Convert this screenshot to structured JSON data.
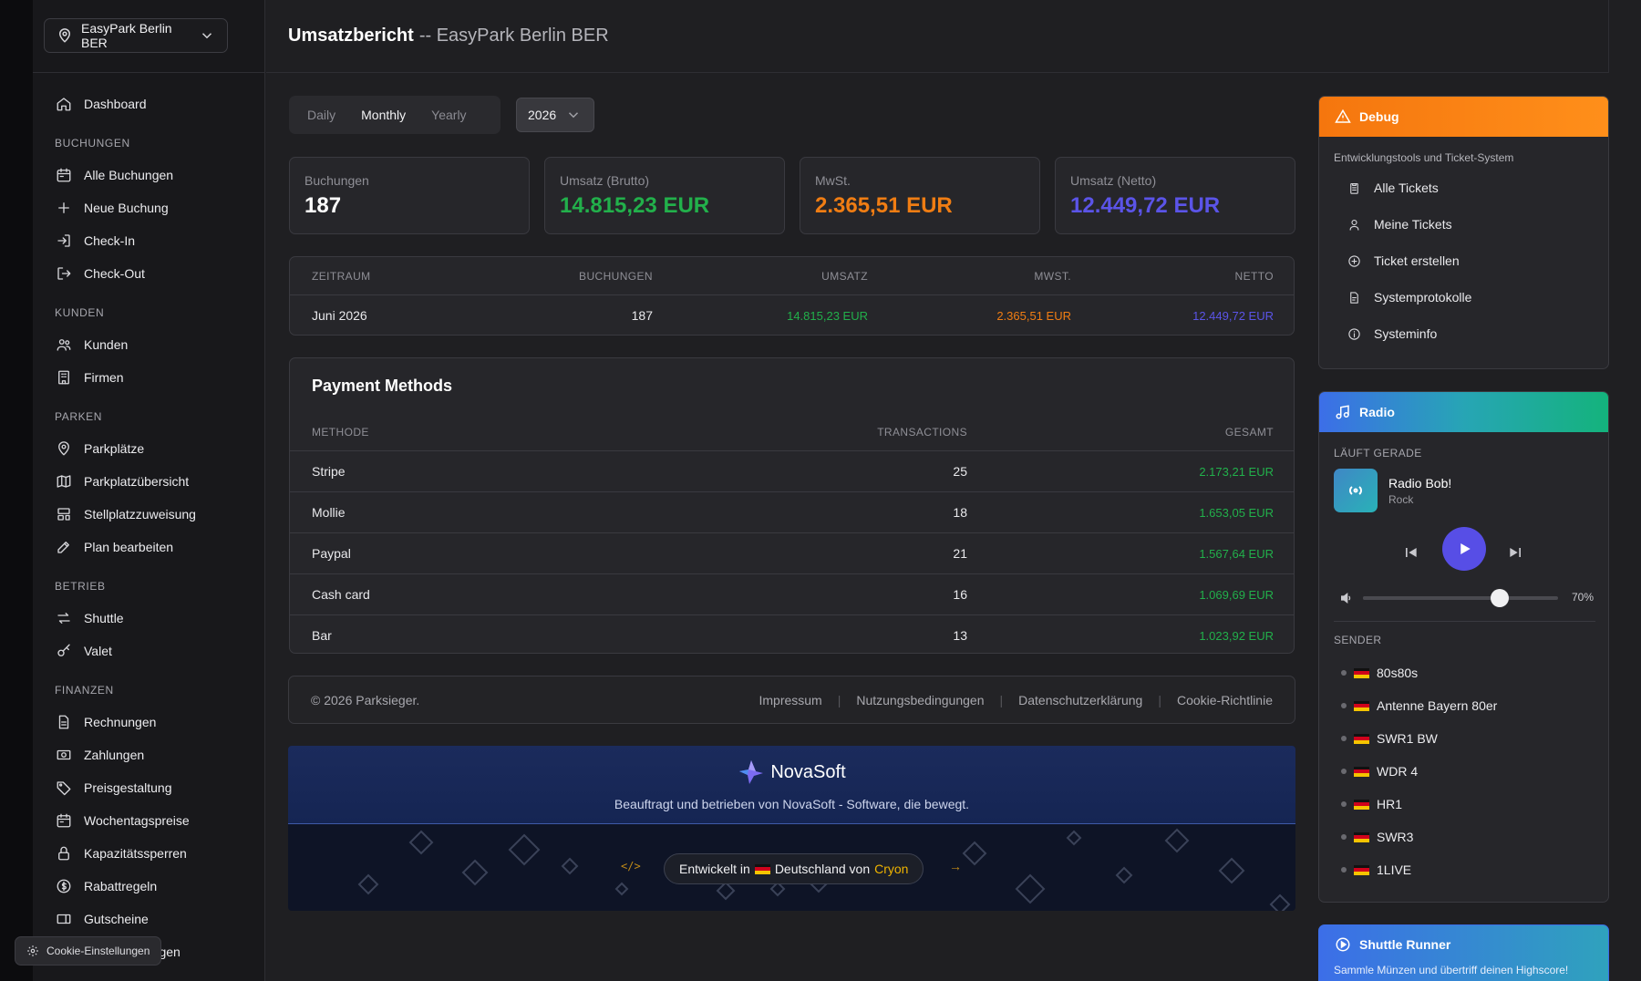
{
  "location": {
    "name": "EasyPark Berlin BER"
  },
  "sidebar": {
    "top": [
      {
        "label": "Dashboard",
        "icon": "home-icon"
      }
    ],
    "sections": [
      {
        "title": "BUCHUNGEN",
        "items": [
          {
            "label": "Alle Buchungen",
            "icon": "calendar-icon"
          },
          {
            "label": "Neue Buchung",
            "icon": "plus-icon"
          },
          {
            "label": "Check-In",
            "icon": "check-in-icon"
          },
          {
            "label": "Check-Out",
            "icon": "check-out-icon"
          }
        ]
      },
      {
        "title": "KUNDEN",
        "items": [
          {
            "label": "Kunden",
            "icon": "users-icon"
          },
          {
            "label": "Firmen",
            "icon": "building-icon"
          }
        ]
      },
      {
        "title": "PARKEN",
        "items": [
          {
            "label": "Parkplätze",
            "icon": "map-pin-icon"
          },
          {
            "label": "Parkplatzübersicht",
            "icon": "map-icon"
          },
          {
            "label": "Stellplatzzuweisung",
            "icon": "assign-icon"
          },
          {
            "label": "Plan bearbeiten",
            "icon": "edit-icon"
          }
        ]
      },
      {
        "title": "BETRIEB",
        "items": [
          {
            "label": "Shuttle",
            "icon": "swap-icon"
          },
          {
            "label": "Valet",
            "icon": "key-icon"
          }
        ]
      },
      {
        "title": "FINANZEN",
        "items": [
          {
            "label": "Rechnungen",
            "icon": "file-icon"
          },
          {
            "label": "Zahlungen",
            "icon": "cash-icon"
          },
          {
            "label": "Preisgestaltung",
            "icon": "tag-icon"
          },
          {
            "label": "Wochentagspreise",
            "icon": "calendar-icon"
          },
          {
            "label": "Kapazitätssperren",
            "icon": "lock-icon"
          },
          {
            "label": "Rabattregeln",
            "icon": "dollar-icon"
          },
          {
            "label": "Gutscheine",
            "icon": "ticket-icon"
          },
          {
            "label": "Zusatzleistungen",
            "icon": "plus-icon"
          }
        ]
      }
    ]
  },
  "header": {
    "title": "Umsatzbericht",
    "subtitle": "-- EasyPark Berlin BER"
  },
  "period": {
    "options": [
      "Daily",
      "Monthly",
      "Yearly"
    ],
    "selected": "Monthly",
    "year": "2026"
  },
  "stats": [
    {
      "label": "Buchungen",
      "value": "187",
      "color": "#ffffff"
    },
    {
      "label": "Umsatz (Brutto)",
      "value": "14.815,23 EUR",
      "color": "#22b04b"
    },
    {
      "label": "MwSt.",
      "value": "2.365,51 EUR",
      "color": "#f07d13"
    },
    {
      "label": "Umsatz (Netto)",
      "value": "12.449,72 EUR",
      "color": "#5b54e8"
    }
  ],
  "summary_table": {
    "headers": [
      "ZEITRAUM",
      "BUCHUNGEN",
      "UMSATZ",
      "MWST.",
      "NETTO"
    ],
    "rows": [
      [
        "Juni 2026",
        "187",
        "14.815,23 EUR",
        "2.365,51 EUR",
        "12.449,72 EUR"
      ]
    ]
  },
  "payments": {
    "title": "Payment Methods",
    "headers": [
      "METHODE",
      "TRANSACTIONS",
      "GESAMT"
    ],
    "rows": [
      [
        "Stripe",
        "25",
        "2.173,21 EUR"
      ],
      [
        "Mollie",
        "18",
        "1.653,05 EUR"
      ],
      [
        "Paypal",
        "21",
        "1.567,64 EUR"
      ],
      [
        "Cash card",
        "16",
        "1.069,69 EUR"
      ],
      [
        "Bar",
        "13",
        "1.023,92 EUR"
      ]
    ]
  },
  "footer": {
    "copyright": "© 2026 Parksieger.",
    "links": [
      "Impressum",
      "Nutzungsbedingungen",
      "Datenschutzerklärung",
      "Cookie-Richtlinie"
    ]
  },
  "banner": {
    "brand": "NovaSoft",
    "tagline": "Beauftragt und betrieben von NovaSoft - Software, die bewegt.",
    "developed_prefix": "Entwickelt in",
    "developed_country": "Deutschland von",
    "developed_by": "Cryon",
    "code_glyph": "</>",
    "arrow_glyph": "→"
  },
  "debug": {
    "title": "Debug",
    "description": "Entwicklungstools und Ticket-System",
    "items": [
      {
        "label": "Alle Tickets",
        "icon": "clipboard-icon"
      },
      {
        "label": "Meine Tickets",
        "icon": "user-icon"
      },
      {
        "label": "Ticket erstellen",
        "icon": "plus-circle-icon"
      },
      {
        "label": "Systemprotokolle",
        "icon": "file-text-icon"
      },
      {
        "label": "Systeminfo",
        "icon": "info-icon"
      }
    ]
  },
  "radio": {
    "title": "Radio",
    "now_playing_label": "LÄUFT GERADE",
    "station": "Radio Bob!",
    "genre": "Rock",
    "volume": 70,
    "volume_text": "70%",
    "stations_label": "SENDER",
    "stations": [
      "80s80s",
      "Antenne Bayern 80er",
      "SWR1 BW",
      "WDR 4",
      "HR1",
      "SWR3",
      "1LIVE"
    ]
  },
  "shuttle_runner": {
    "title": "Shuttle Runner",
    "subtitle": "Sammle Münzen und übertriff deinen Highscore!"
  },
  "cookie": {
    "label": "Cookie-Einstellungen"
  }
}
